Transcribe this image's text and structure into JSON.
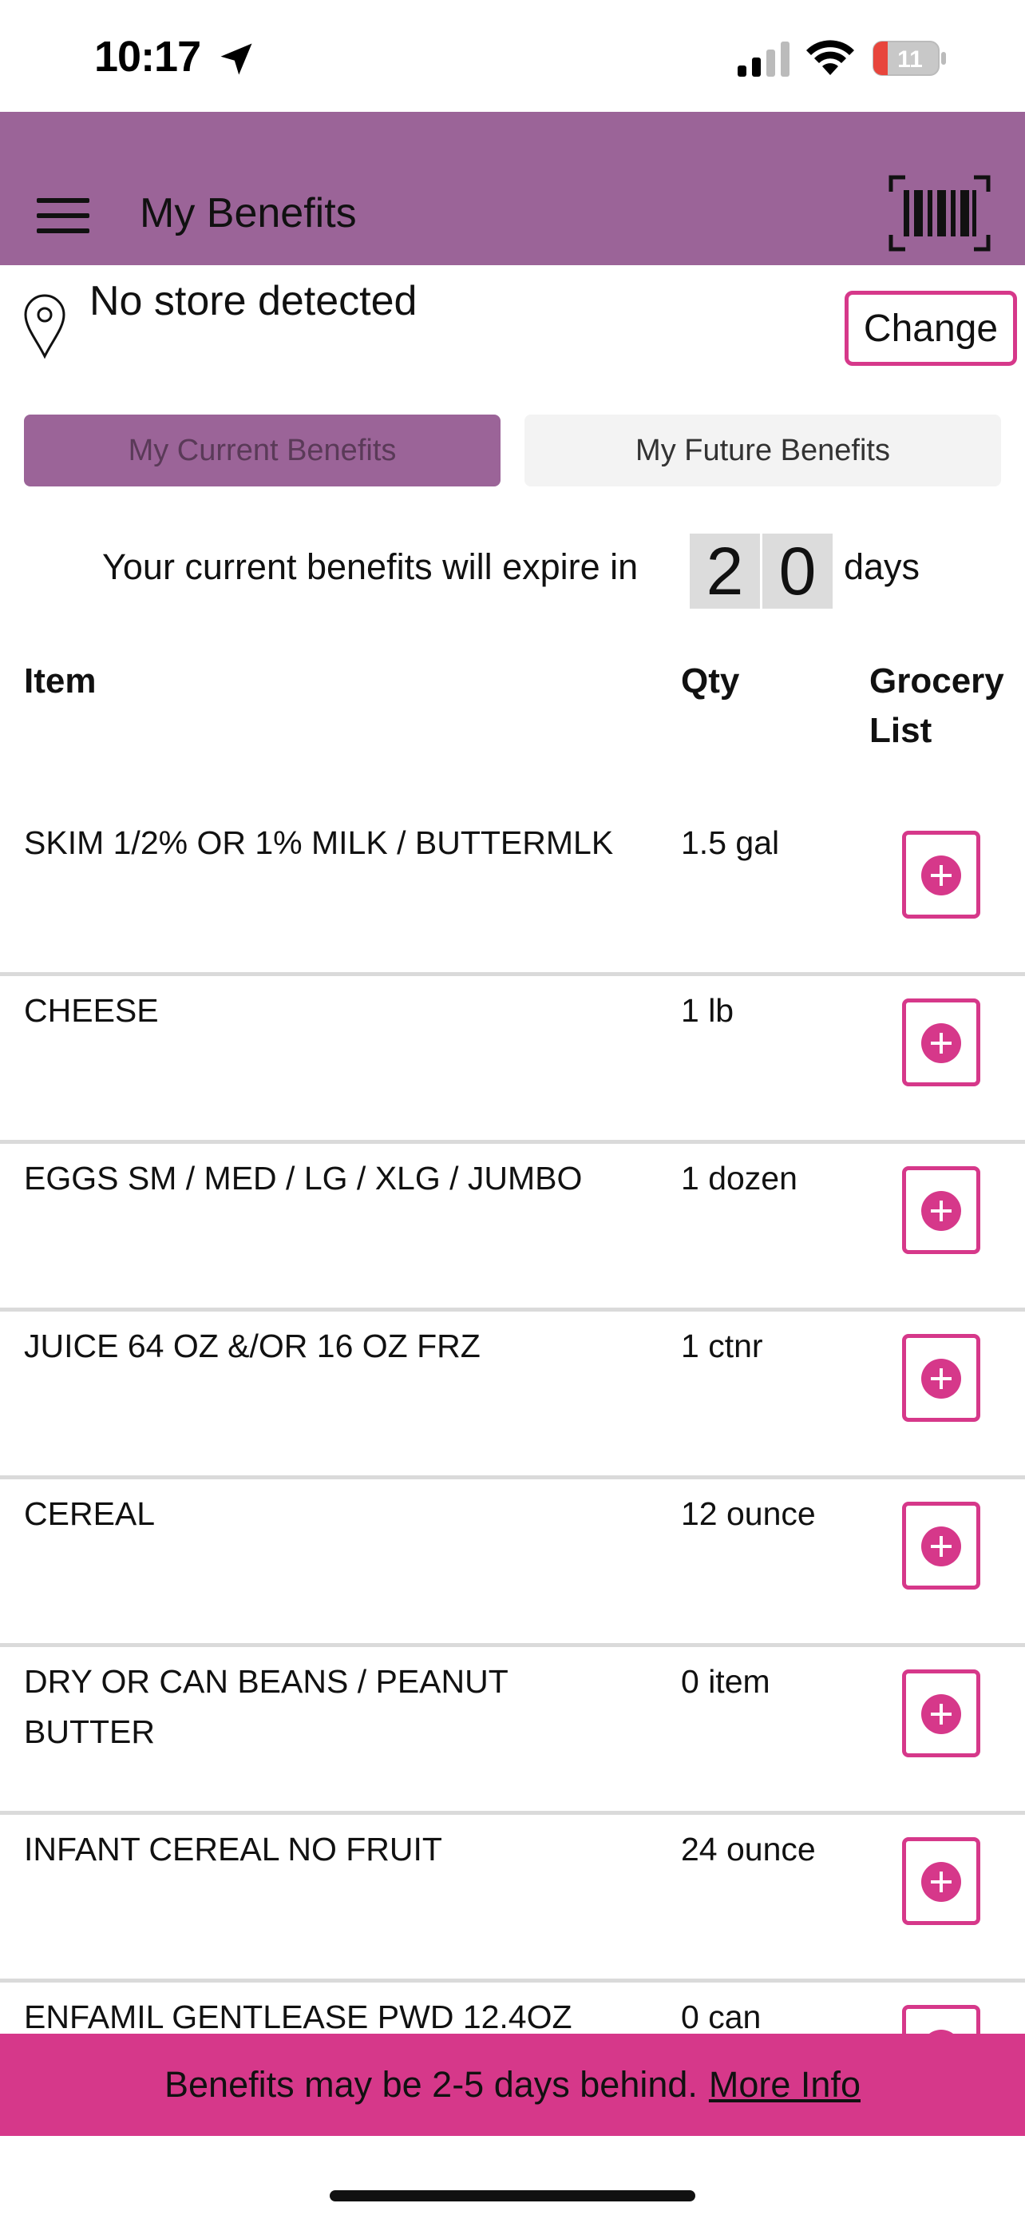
{
  "status_bar": {
    "time": "10:17",
    "battery": "11"
  },
  "header": {
    "title": "My Benefits"
  },
  "store": {
    "text": "No store detected",
    "change_label": "Change"
  },
  "tabs": [
    {
      "label": "My Current Benefits",
      "active": true
    },
    {
      "label": "My Future Benefits",
      "active": false
    }
  ],
  "expiry": {
    "prefix": "Your current benefits will expire in",
    "digits": [
      "2",
      "0"
    ],
    "suffix": "days"
  },
  "table": {
    "headers": {
      "item": "Item",
      "qty": "Qty",
      "grocery": "Grocery List"
    },
    "rows": [
      {
        "item": "SKIM 1/2% OR 1% MILK / BUTTERMLK",
        "qty": "1.5 gal"
      },
      {
        "item": "CHEESE",
        "qty": "1 lb"
      },
      {
        "item": "EGGS SM / MED / LG / XLG / JUMBO",
        "qty": "1 dozen"
      },
      {
        "item": "JUICE 64 OZ &/OR 16 OZ FRZ",
        "qty": "1 ctnr"
      },
      {
        "item": "CEREAL",
        "qty": "12 ounce"
      },
      {
        "item": "DRY OR CAN BEANS / PEANUT BUTTER",
        "qty": "0 item"
      },
      {
        "item": "INFANT CEREAL NO FRUIT",
        "qty": "24 ounce"
      },
      {
        "item": "ENFAMIL GENTLEASE PWD 12.4OZ",
        "qty": "0 can"
      }
    ]
  },
  "banner": {
    "text": "Benefits may be 2-5 days behind.",
    "link": "More Info"
  },
  "colors": {
    "header": "#9b6498",
    "accent": "#d6388a"
  }
}
